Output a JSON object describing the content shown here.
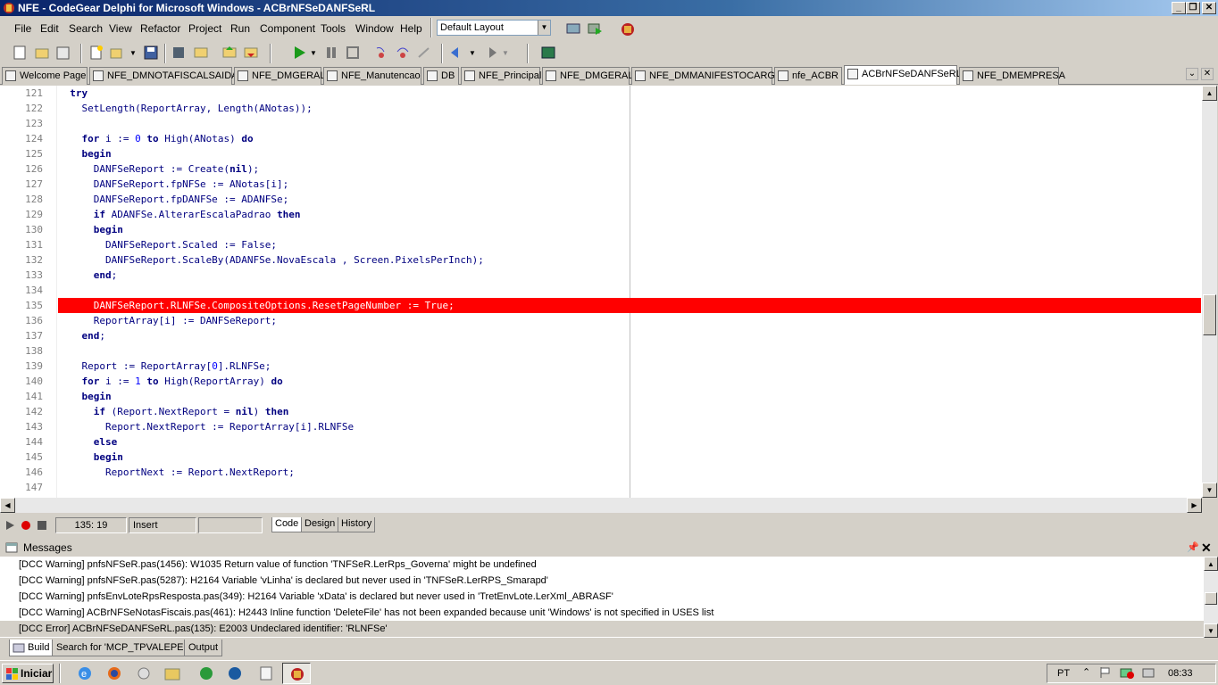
{
  "window": {
    "title": "NFE - CodeGear Delphi for Microsoft Windows - ACBrNFSeDANFSeRL",
    "minimize": "_",
    "restore": "❐",
    "close": "✕"
  },
  "menu": [
    "File",
    "Edit",
    "Search",
    "View",
    "Refactor",
    "Project",
    "Run",
    "Component",
    "Tools",
    "Window",
    "Help"
  ],
  "layout_select": {
    "value": "Default Layout"
  },
  "tabs": [
    "Welcome Page",
    "NFE_DMNOTAFISCALSAIDA",
    "NFE_DMGERAL",
    "NFE_Manutencao",
    "DB",
    "NFE_Principal",
    "NFE_DMGERAL",
    "NFE_DMMANIFESTOCARGA",
    "nfe_ACBR",
    "ACBrNFSeDANFSeRL",
    "NFE_DMEMPRESA"
  ],
  "editor": {
    "line_numbers": [
      "121",
      "122",
      "123",
      "124",
      "125",
      "126",
      "127",
      "128",
      "129",
      "130",
      "131",
      "132",
      "133",
      "134",
      "135",
      "136",
      "137",
      "138",
      "139",
      "140",
      "141",
      "142",
      "143",
      "144",
      "145",
      "146",
      "147"
    ],
    "lines": [
      "  try",
      "    SetLength(ReportArray, Length(ANotas));",
      "",
      "    for i := 0 to High(ANotas) do",
      "    begin",
      "      DANFSeReport := Create(nil);",
      "      DANFSeReport.fpNFSe := ANotas[i];",
      "      DANFSeReport.fpDANFSe := ADANFSe;",
      "      if ADANFSe.AlterarEscalaPadrao then",
      "      begin",
      "        DANFSeReport.Scaled := False;",
      "        DANFSeReport.ScaleBy(ADANFSe.NovaEscala , Screen.PixelsPerInch);",
      "      end;",
      "",
      "      DANFSeReport.RLNFSe.CompositeOptions.ResetPageNumber := True;",
      "      ReportArray[i] := DANFSeReport;",
      "    end;",
      "",
      "    Report := ReportArray[0].RLNFSe;",
      "    for i := 1 to High(ReportArray) do",
      "    begin",
      "      if (Report.NextReport = nil) then",
      "        Report.NextReport := ReportArray[i].RLNFSe",
      "      else",
      "      begin",
      "        ReportNext := Report.NextReport;",
      ""
    ],
    "error_line_index": 14
  },
  "status": {
    "position": "135: 19",
    "mode": "Insert",
    "view_tabs": [
      "Code",
      "Design",
      "History"
    ]
  },
  "messages": {
    "title": "Messages",
    "items": [
      "[DCC Warning] pnfsNFSeR.pas(1456): W1035 Return value of function 'TNFSeR.LerRps_Governa' might be undefined",
      "[DCC Warning] pnfsNFSeR.pas(5287): H2164 Variable 'vLinha' is declared but never used in 'TNFSeR.LerRPS_Smarapd'",
      "[DCC Warning] pnfsEnvLoteRpsResposta.pas(349): H2164 Variable 'xData' is declared but never used in 'TretEnvLote.LerXml_ABRASF'",
      "[DCC Warning] ACBrNFSeNotasFiscais.pas(461): H2443 Inline function 'DeleteFile' has not been expanded because unit 'Windows' is not specified in USES list",
      "[DCC Error] ACBrNFSeDANFSeRL.pas(135): E2003 Undeclared identifier: 'RLNFSe'"
    ],
    "tabs": [
      "Build",
      "Search for 'MCP_TPVALEPED'",
      "Output"
    ]
  },
  "taskbar": {
    "start": "Iniciar",
    "lang": "PT",
    "clock": "08:33"
  },
  "colors": {
    "error_line": "#ff0000",
    "title_start": "#0a246a"
  }
}
